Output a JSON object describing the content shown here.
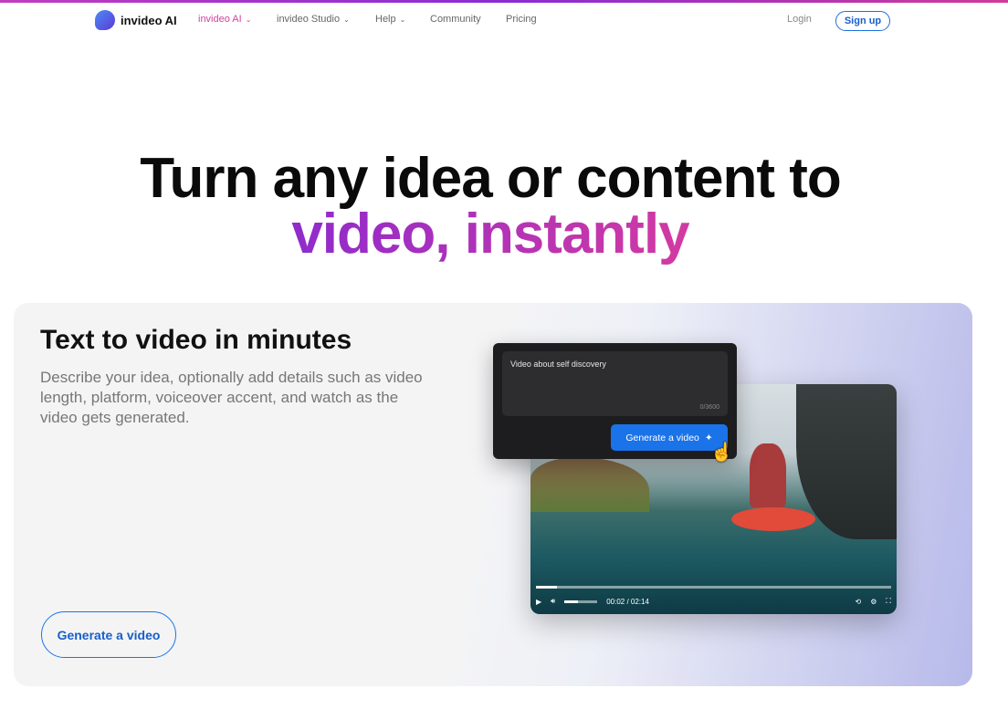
{
  "nav": {
    "brand": "invideo AI",
    "items": [
      {
        "label": "invideo AI",
        "active": true
      },
      {
        "label": "invideo Studio"
      },
      {
        "label": "Help"
      },
      {
        "label": "Community"
      },
      {
        "label": "Pricing"
      }
    ],
    "login": "Login",
    "signup": "Sign up"
  },
  "hero": {
    "line1": "Turn any idea or content to",
    "line2": "video, instantly"
  },
  "card": {
    "title": "Text to video in minutes",
    "description": "Describe your idea, optionally add details such as video length, platform, voiceover accent, and watch as the video gets generated.",
    "cta": "Generate a video"
  },
  "demo": {
    "prompt": "Video about self discovery",
    "char_count": "0/3600",
    "button": "Generate a video",
    "time": "00:02 / 02:14",
    "progress_percent": 1.5
  },
  "colors": {
    "accent": "#1a73e8",
    "active_nav": "#d6409f",
    "headline_gradient": [
      "#8f2bcc",
      "#d33aa2"
    ]
  }
}
